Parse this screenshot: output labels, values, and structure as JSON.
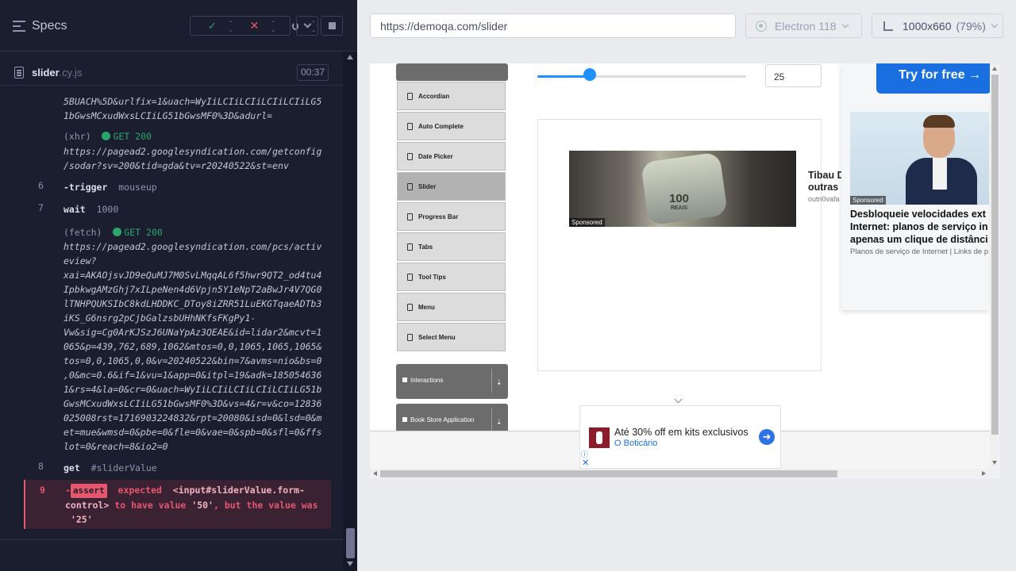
{
  "reporter": {
    "specs_label": "Specs",
    "stats": {
      "passed": "--",
      "failed": "--",
      "pending": "--"
    },
    "file": {
      "name": "slider",
      "ext": ".cy.js",
      "duration": "00:37"
    },
    "log": {
      "l1": "5BUACH%5D&urlfix=1&uach=WyIiLCIiLCIiLCIiLCIiLG5\n1bGwsMCxudWxsLCIiLG51bGwsMF0%3D&adurl=",
      "xhr_label": "(xhr)",
      "xhr_method": "GET 200",
      "xhr_url": "https://pagead2.googlesyndication.com/getconfig\n/sodar?sv=200&tid=gda&tv=r20240522&st=env",
      "n6": "6",
      "trigger_cmd": "-trigger",
      "trigger_arg": "mouseup",
      "n7": "7",
      "wait_cmd": "wait",
      "wait_arg": "1000",
      "fetch_label": "(fetch)",
      "fetch_method": "GET 200",
      "fetch_url": "https://pagead2.googlesyndication.com/pcs/activ\neview?\nxai=AKAOjsvJD9eQuMJ7M0SvLMqqAL6f5hwr9QT2_od4tu4\nIpbkwgAMzGhj7xILpeNen4d6Vpjn5Y1eNpT2aBwJr4V7QG0\nlTNHPQUKSIbC8kdLHDDKC_DToy8iZRR51LuEKGTqaeADTb3\niKS_G6nsrg2pCjbGalzsbUHhNKfsFKgPy1-\nVw&sig=Cg0ArKJSzJ6UNaYpAz3QEAE&id=lidar2&mcvt=1\n065&p=439,762,689,1062&mtos=0,0,1065,1065,1065&\ntos=0,0,1065,0,0&v=20240522&bin=7&avms=nio&bs=0\n,0&mc=0.6&if=1&vu=1&app=0&itpl=19&adk=185054636\n1&rs=4&la=0&cr=0&uach=WyIiLCIiLCIiLCIiLCIiLG51b\nGwsMCxudWxsLCIiLG51bGwsMF0%3D&vs=4&r=v&co=12836\n025008rst=1716903224832&rpt=20080&isd=0&lsd=0&m\net=mue&wmsd=0&pbe=0&fle=0&vae=0&spb=0&sfl=0&ffs\nlot=0&reach=8&io2=0",
      "n8": "8",
      "get_cmd": "get",
      "get_arg": "#sliderValue",
      "n9": "9",
      "assert_tag": "assert",
      "assert_p1": "expected",
      "assert_subject": "<input#sliderValue.form-\ncontrol>",
      "assert_p2": "to have value",
      "assert_expected": "'50'",
      "assert_p3": ", but the value was",
      "assert_actual": "'25'"
    }
  },
  "aut": {
    "url": "https://demoqa.com/slider",
    "browser": "Electron 118",
    "viewport": "1000x660",
    "viewport_pct": "(79%)",
    "page": {
      "sidebar_items": [
        "Accordian",
        "Auto Complete",
        "Date Picker",
        "Slider",
        "Progress Bar",
        "Tabs",
        "Tool Tips",
        "Menu",
        "Select Menu"
      ],
      "active_item": "Slider",
      "groups": [
        "Interactions",
        "Book Store Application"
      ],
      "slider_value": "25",
      "slider_level": 0.25,
      "ad_sponsored": "Sponsored",
      "ad_bill_text": "100",
      "ad_bill_sub": "REAIS",
      "ad_side_title": "Tibau D\noutras",
      "ad_side_source": "outn0vafa",
      "right_ad_try": "Try for free →",
      "right_ad_headline": "Desbloqueie velocidades ext\nInternet: planos de serviço in\napenas um clique de distânci",
      "right_ad_sub": "Planos de serviço de Internet | Links de p",
      "bottom_ad_title": "Até 30% off em kits exclusivos",
      "bottom_ad_brand": "O Boticário"
    }
  }
}
